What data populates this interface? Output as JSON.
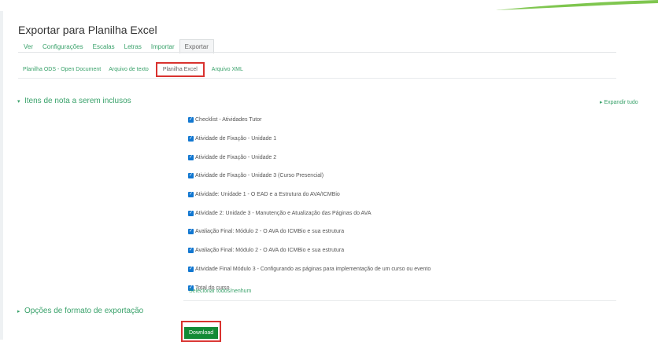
{
  "page": {
    "title": "Exportar para Planilha Excel"
  },
  "nav": {
    "primary_tabs": [
      {
        "label": "Ver"
      },
      {
        "label": "Configurações"
      },
      {
        "label": "Escalas"
      },
      {
        "label": "Letras"
      },
      {
        "label": "Importar"
      },
      {
        "label": "Exportar",
        "active": true
      }
    ],
    "secondary_tabs": [
      {
        "label": "Planilha ODS - Open Document"
      },
      {
        "label": "Arquivo de texto"
      },
      {
        "label": "Planilha Excel",
        "active": true
      },
      {
        "label": "Arquivo XML"
      }
    ]
  },
  "expand_all": "Expandir tudo",
  "grade_items": {
    "heading": "Itens de nota a serem inclusos",
    "items": [
      {
        "label": "Checklist - Atividades Tutor",
        "checked": true
      },
      {
        "label": "Atividade de Fixação - Unidade 1",
        "checked": true
      },
      {
        "label": "Atividade de Fixação - Unidade 2",
        "checked": true
      },
      {
        "label": "Atividade de Fixação - Unidade 3 (Curso Presencial)",
        "checked": true
      },
      {
        "label": "Atividade: Unidade 1 - O EAD e a Estrutura do AVA/ICMBio",
        "checked": true
      },
      {
        "label": "Atividade 2: Unidade 3 - Manutenção e Atualização das Páginas do AVA",
        "checked": true
      },
      {
        "label": "Avaliação Final: Módulo 2 - O AVA do ICMBio e sua estrutura",
        "checked": true
      },
      {
        "label": "Avaliação Final: Módulo 2 - O AVA do ICMBio e sua estrutura",
        "checked": true
      },
      {
        "label": "Atividade Final Módulo 3 - Configurando as páginas para implementação de um curso ou evento",
        "checked": true
      },
      {
        "label": "Total do curso",
        "checked": true
      }
    ],
    "select_all": "Selecionar todos/nenhum"
  },
  "format_options": {
    "heading": "Opções de formato de exportação"
  },
  "download": {
    "label": "Download"
  },
  "colors": {
    "accent_green": "#3aa26b",
    "checkbox_blue": "#1177d1",
    "button_green": "#138a35",
    "highlight_red": "#d9322f"
  }
}
